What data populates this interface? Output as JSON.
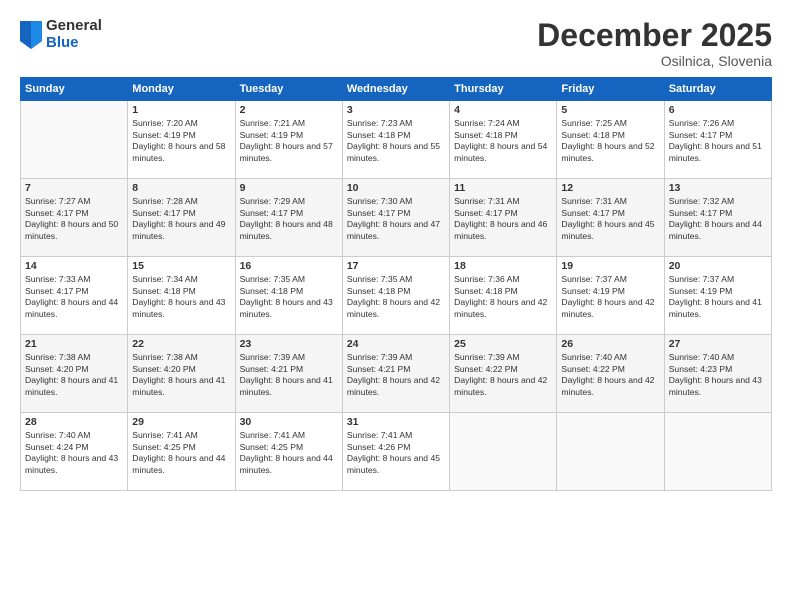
{
  "logo": {
    "general": "General",
    "blue": "Blue"
  },
  "title": "December 2025",
  "location": "Osilnica, Slovenia",
  "days_header": [
    "Sunday",
    "Monday",
    "Tuesday",
    "Wednesday",
    "Thursday",
    "Friday",
    "Saturday"
  ],
  "weeks": [
    [
      {
        "num": "",
        "sunrise": "",
        "sunset": "",
        "daylight": ""
      },
      {
        "num": "1",
        "sunrise": "Sunrise: 7:20 AM",
        "sunset": "Sunset: 4:19 PM",
        "daylight": "Daylight: 8 hours and 58 minutes."
      },
      {
        "num": "2",
        "sunrise": "Sunrise: 7:21 AM",
        "sunset": "Sunset: 4:19 PM",
        "daylight": "Daylight: 8 hours and 57 minutes."
      },
      {
        "num": "3",
        "sunrise": "Sunrise: 7:23 AM",
        "sunset": "Sunset: 4:18 PM",
        "daylight": "Daylight: 8 hours and 55 minutes."
      },
      {
        "num": "4",
        "sunrise": "Sunrise: 7:24 AM",
        "sunset": "Sunset: 4:18 PM",
        "daylight": "Daylight: 8 hours and 54 minutes."
      },
      {
        "num": "5",
        "sunrise": "Sunrise: 7:25 AM",
        "sunset": "Sunset: 4:18 PM",
        "daylight": "Daylight: 8 hours and 52 minutes."
      },
      {
        "num": "6",
        "sunrise": "Sunrise: 7:26 AM",
        "sunset": "Sunset: 4:17 PM",
        "daylight": "Daylight: 8 hours and 51 minutes."
      }
    ],
    [
      {
        "num": "7",
        "sunrise": "Sunrise: 7:27 AM",
        "sunset": "Sunset: 4:17 PM",
        "daylight": "Daylight: 8 hours and 50 minutes."
      },
      {
        "num": "8",
        "sunrise": "Sunrise: 7:28 AM",
        "sunset": "Sunset: 4:17 PM",
        "daylight": "Daylight: 8 hours and 49 minutes."
      },
      {
        "num": "9",
        "sunrise": "Sunrise: 7:29 AM",
        "sunset": "Sunset: 4:17 PM",
        "daylight": "Daylight: 8 hours and 48 minutes."
      },
      {
        "num": "10",
        "sunrise": "Sunrise: 7:30 AM",
        "sunset": "Sunset: 4:17 PM",
        "daylight": "Daylight: 8 hours and 47 minutes."
      },
      {
        "num": "11",
        "sunrise": "Sunrise: 7:31 AM",
        "sunset": "Sunset: 4:17 PM",
        "daylight": "Daylight: 8 hours and 46 minutes."
      },
      {
        "num": "12",
        "sunrise": "Sunrise: 7:31 AM",
        "sunset": "Sunset: 4:17 PM",
        "daylight": "Daylight: 8 hours and 45 minutes."
      },
      {
        "num": "13",
        "sunrise": "Sunrise: 7:32 AM",
        "sunset": "Sunset: 4:17 PM",
        "daylight": "Daylight: 8 hours and 44 minutes."
      }
    ],
    [
      {
        "num": "14",
        "sunrise": "Sunrise: 7:33 AM",
        "sunset": "Sunset: 4:17 PM",
        "daylight": "Daylight: 8 hours and 44 minutes."
      },
      {
        "num": "15",
        "sunrise": "Sunrise: 7:34 AM",
        "sunset": "Sunset: 4:18 PM",
        "daylight": "Daylight: 8 hours and 43 minutes."
      },
      {
        "num": "16",
        "sunrise": "Sunrise: 7:35 AM",
        "sunset": "Sunset: 4:18 PM",
        "daylight": "Daylight: 8 hours and 43 minutes."
      },
      {
        "num": "17",
        "sunrise": "Sunrise: 7:35 AM",
        "sunset": "Sunset: 4:18 PM",
        "daylight": "Daylight: 8 hours and 42 minutes."
      },
      {
        "num": "18",
        "sunrise": "Sunrise: 7:36 AM",
        "sunset": "Sunset: 4:18 PM",
        "daylight": "Daylight: 8 hours and 42 minutes."
      },
      {
        "num": "19",
        "sunrise": "Sunrise: 7:37 AM",
        "sunset": "Sunset: 4:19 PM",
        "daylight": "Daylight: 8 hours and 42 minutes."
      },
      {
        "num": "20",
        "sunrise": "Sunrise: 7:37 AM",
        "sunset": "Sunset: 4:19 PM",
        "daylight": "Daylight: 8 hours and 41 minutes."
      }
    ],
    [
      {
        "num": "21",
        "sunrise": "Sunrise: 7:38 AM",
        "sunset": "Sunset: 4:20 PM",
        "daylight": "Daylight: 8 hours and 41 minutes."
      },
      {
        "num": "22",
        "sunrise": "Sunrise: 7:38 AM",
        "sunset": "Sunset: 4:20 PM",
        "daylight": "Daylight: 8 hours and 41 minutes."
      },
      {
        "num": "23",
        "sunrise": "Sunrise: 7:39 AM",
        "sunset": "Sunset: 4:21 PM",
        "daylight": "Daylight: 8 hours and 41 minutes."
      },
      {
        "num": "24",
        "sunrise": "Sunrise: 7:39 AM",
        "sunset": "Sunset: 4:21 PM",
        "daylight": "Daylight: 8 hours and 42 minutes."
      },
      {
        "num": "25",
        "sunrise": "Sunrise: 7:39 AM",
        "sunset": "Sunset: 4:22 PM",
        "daylight": "Daylight: 8 hours and 42 minutes."
      },
      {
        "num": "26",
        "sunrise": "Sunrise: 7:40 AM",
        "sunset": "Sunset: 4:22 PM",
        "daylight": "Daylight: 8 hours and 42 minutes."
      },
      {
        "num": "27",
        "sunrise": "Sunrise: 7:40 AM",
        "sunset": "Sunset: 4:23 PM",
        "daylight": "Daylight: 8 hours and 43 minutes."
      }
    ],
    [
      {
        "num": "28",
        "sunrise": "Sunrise: 7:40 AM",
        "sunset": "Sunset: 4:24 PM",
        "daylight": "Daylight: 8 hours and 43 minutes."
      },
      {
        "num": "29",
        "sunrise": "Sunrise: 7:41 AM",
        "sunset": "Sunset: 4:25 PM",
        "daylight": "Daylight: 8 hours and 44 minutes."
      },
      {
        "num": "30",
        "sunrise": "Sunrise: 7:41 AM",
        "sunset": "Sunset: 4:25 PM",
        "daylight": "Daylight: 8 hours and 44 minutes."
      },
      {
        "num": "31",
        "sunrise": "Sunrise: 7:41 AM",
        "sunset": "Sunset: 4:26 PM",
        "daylight": "Daylight: 8 hours and 45 minutes."
      },
      {
        "num": "",
        "sunrise": "",
        "sunset": "",
        "daylight": ""
      },
      {
        "num": "",
        "sunrise": "",
        "sunset": "",
        "daylight": ""
      },
      {
        "num": "",
        "sunrise": "",
        "sunset": "",
        "daylight": ""
      }
    ]
  ]
}
